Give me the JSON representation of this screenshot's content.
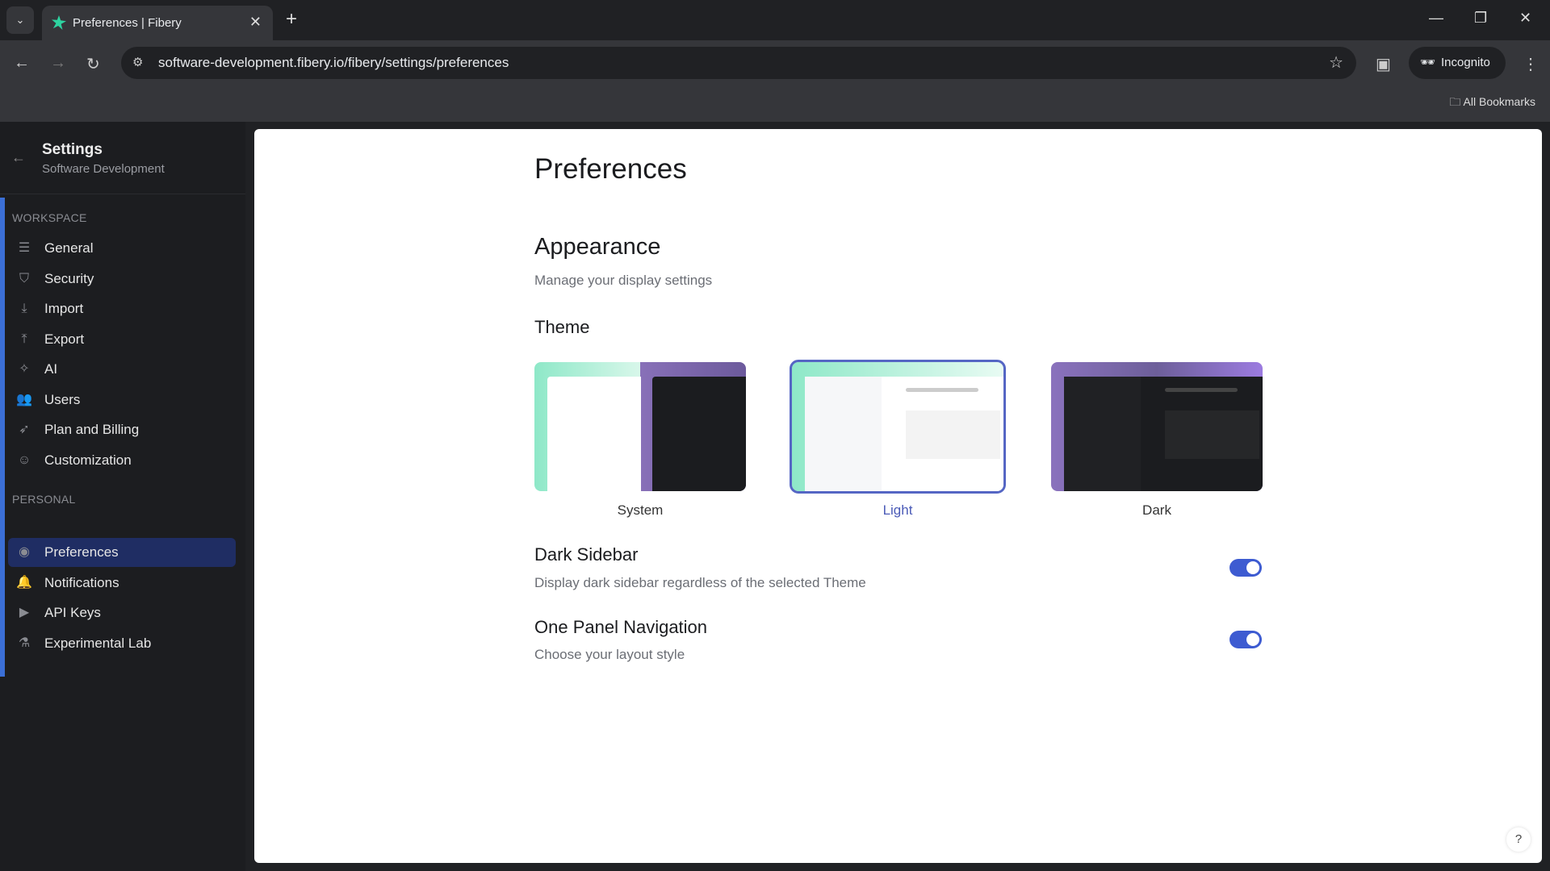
{
  "browser": {
    "tab_title": "Preferences | Fibery",
    "url": "software-development.fibery.io/fibery/settings/preferences",
    "incognito_label": "Incognito",
    "bookmarks_label": "All Bookmarks"
  },
  "sidebar": {
    "title": "Settings",
    "subtitle": "Software Development",
    "sections": [
      {
        "label": "WORKSPACE",
        "items": [
          {
            "label": "General",
            "icon": "sliders-icon"
          },
          {
            "label": "Security",
            "icon": "shield-icon"
          },
          {
            "label": "Import",
            "icon": "import-icon"
          },
          {
            "label": "Export",
            "icon": "export-icon"
          },
          {
            "label": "AI",
            "icon": "sparkle-icon"
          },
          {
            "label": "Users",
            "icon": "users-icon"
          },
          {
            "label": "Plan and Billing",
            "icon": "rocket-icon"
          },
          {
            "label": "Customization",
            "icon": "smiley-icon"
          }
        ]
      },
      {
        "label": "PERSONAL",
        "items": [
          {
            "label": "Preferences",
            "icon": "user-circle-icon",
            "active": true
          },
          {
            "label": "Notifications",
            "icon": "bell-icon"
          },
          {
            "label": "API Keys",
            "icon": "terminal-icon"
          },
          {
            "label": "Experimental Lab",
            "icon": "flask-icon"
          }
        ]
      }
    ]
  },
  "main": {
    "title": "Preferences",
    "section_title": "Appearance",
    "section_desc": "Manage your display settings",
    "theme_label": "Theme",
    "themes": [
      {
        "label": "System"
      },
      {
        "label": "Light",
        "selected": true
      },
      {
        "label": "Dark"
      }
    ],
    "dark_sidebar": {
      "title": "Dark Sidebar",
      "desc": "Display dark sidebar regardless of the selected Theme",
      "on": true
    },
    "one_panel": {
      "title": "One Panel Navigation",
      "desc": "Choose your layout style",
      "on": true
    },
    "help": "?"
  },
  "colors": {
    "accent": "#3d5bd1",
    "sidebar_bg": "#1c1d20",
    "active_item": "#1f2d63"
  }
}
